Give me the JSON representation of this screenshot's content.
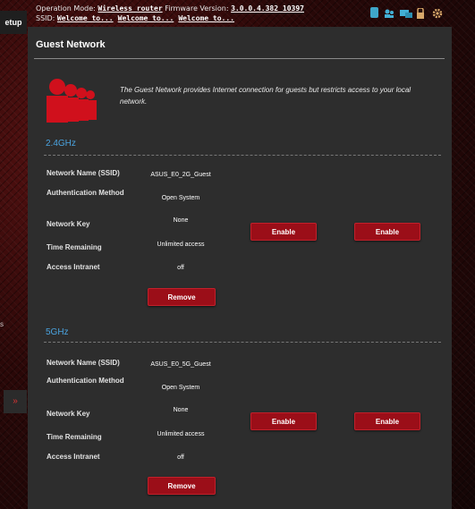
{
  "header": {
    "op_mode_label": "Operation Mode:",
    "op_mode_value": "Wireless router",
    "fw_label": "Firmware Version:",
    "fw_value": "3.0.0.4.382_10397",
    "ssid_label": "SSID:",
    "ssid_values": [
      "Welcome to...",
      "Welcome to...",
      "Welcome to..."
    ],
    "status_icons": [
      "usb-icon",
      "user-icon",
      "network-icon",
      "lock-icon",
      "settings-icon"
    ]
  },
  "sidebar": {
    "setup_tab_label": "etup",
    "fragment_label": "s",
    "arrow_label": "»"
  },
  "page": {
    "title": "Guest Network",
    "description": "The Guest Network provides Internet connection for guests but restricts access to your local network."
  },
  "bands": [
    {
      "name": "2.4GHz",
      "labels": {
        "ssid": "Network Name (SSID)",
        "auth": "Authentication Method",
        "key": "Network Key",
        "time": "Time Remaining",
        "intranet": "Access Intranet"
      },
      "values": {
        "ssid": "ASUS_E0_2G_Guest",
        "auth": "Open System",
        "key": "None",
        "time": "Unlimited access",
        "intranet": "off"
      },
      "enable_buttons": [
        "Enable",
        "Enable"
      ],
      "remove_label": "Remove"
    },
    {
      "name": "5GHz",
      "labels": {
        "ssid": "Network Name (SSID)",
        "auth": "Authentication Method",
        "key": "Network Key",
        "time": "Time Remaining",
        "intranet": "Access Intranet"
      },
      "values": {
        "ssid": "ASUS_E0_5G_Guest",
        "auth": "Open System",
        "key": "None",
        "time": "Unlimited access",
        "intranet": "off"
      },
      "enable_buttons": [
        "Enable",
        "Enable"
      ],
      "remove_label": "Remove"
    }
  ],
  "colors": {
    "accent_red": "#9b0e18",
    "band_blue": "#4aa3df",
    "panel_bg": "#2d2d2d"
  }
}
